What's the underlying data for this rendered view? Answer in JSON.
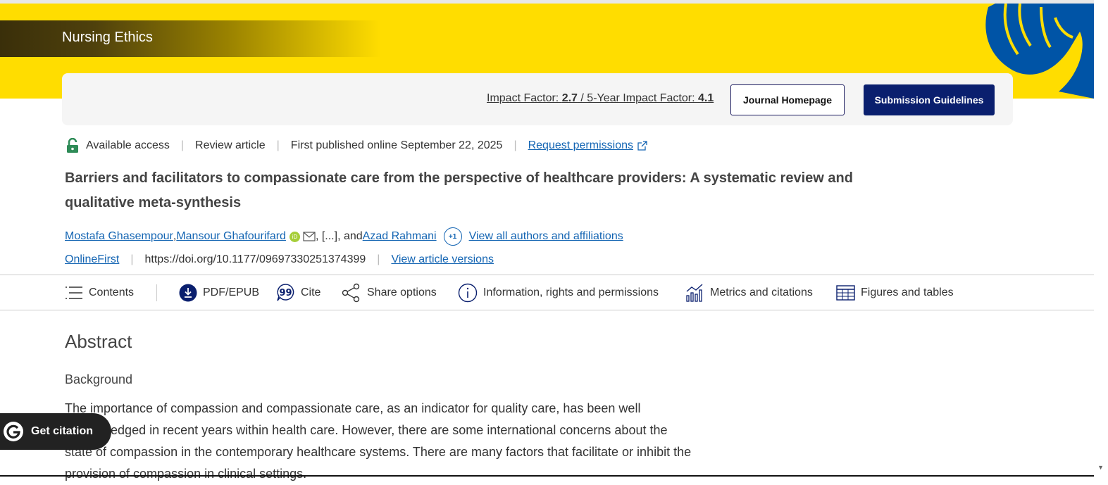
{
  "journal": {
    "name": "Nursing Ethics"
  },
  "metrics_bar": {
    "impact_label": "Impact Factor: ",
    "impact_value": "2.7",
    "five_year_label": " / 5-Year Impact Factor: ",
    "five_year_value": "4.1",
    "homepage_button": "Journal Homepage",
    "guidelines_button": "Submission Guidelines"
  },
  "article_meta": {
    "access": "Available access",
    "type": "Review article",
    "published": "First published online September 22, 2025",
    "permissions_link": "Request permissions"
  },
  "title": "Barriers and facilitators to compassionate care from the perspective of healthcare providers: A systematic review and qualitative meta-synthesis",
  "authors": {
    "author1": "Mostafa Ghasempour",
    "comma1": ", ",
    "author2": "Mansour Ghafourifard",
    "orcid": "iD",
    "ellipsis": ", [...], and ",
    "author3": "Azad Rahmani",
    "more_count": "+1",
    "view_all": "View all authors and affiliations"
  },
  "doi_row": {
    "online_first": "OnlineFirst",
    "doi": "https://doi.org/10.1177/09697330251374399",
    "versions": "View article versions"
  },
  "toolbar": {
    "contents": "Contents",
    "pdf": "PDF/EPUB",
    "cite": "Cite",
    "share": "Share options",
    "info": "Information, rights and permissions",
    "metrics": "Metrics and citations",
    "figures": "Figures and tables"
  },
  "abstract": {
    "heading": "Abstract",
    "subheading": "Background",
    "text": "The importance of compassion and compassionate care, as an indicator for quality care, has been well acknowledged in recent years within health care. However, there are some international concerns about the state of compassion in the contemporary healthcare systems. There are many factors that facilitate or inhibit the provision of compassion in clinical settings."
  },
  "get_citation": "Get citation",
  "colors": {
    "banner": "#ffdd00",
    "primary": "#0a1f6e",
    "link": "#1465b3",
    "access": "#2e8b57"
  }
}
